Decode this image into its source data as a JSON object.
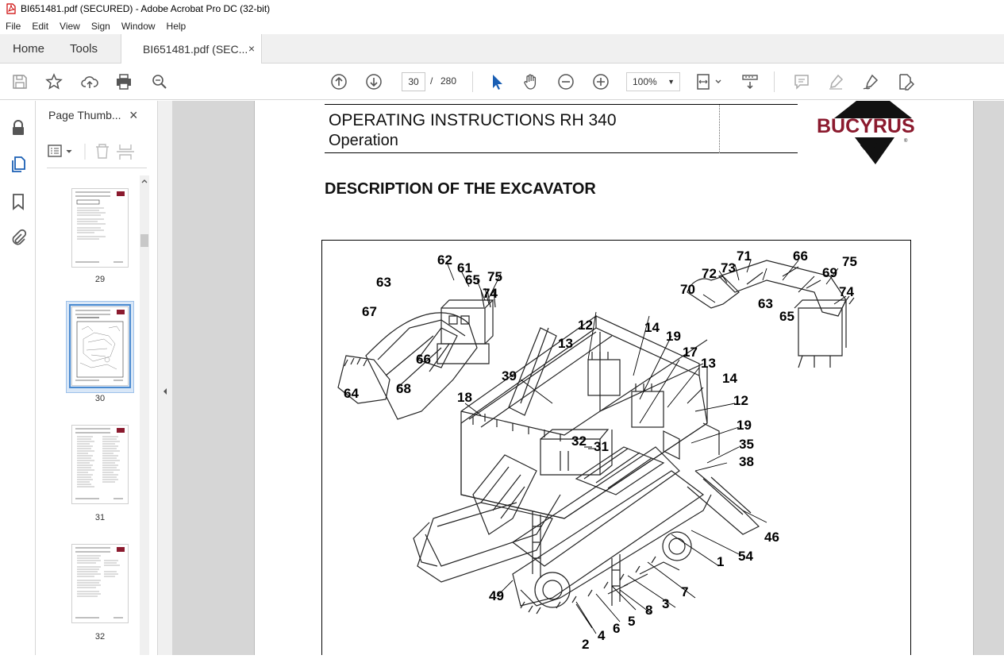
{
  "window": {
    "title": "BI651481.pdf (SECURED) - Adobe Acrobat Pro DC (32-bit)"
  },
  "menu": [
    "File",
    "Edit",
    "View",
    "Sign",
    "Window",
    "Help"
  ],
  "tabs": {
    "home": "Home",
    "tools": "Tools",
    "document": "BI651481.pdf (SEC...",
    "close": "×"
  },
  "toolbar": {
    "current_page": "30",
    "separator": "/",
    "total_pages": "280",
    "zoom": "100%"
  },
  "thumbnails_panel": {
    "title": "Page Thumb...",
    "close": "×",
    "pages": [
      {
        "number": "29"
      },
      {
        "number": "30",
        "selected": true
      },
      {
        "number": "31"
      },
      {
        "number": "32"
      }
    ]
  },
  "document": {
    "header_line1": "OPERATING INSTRUCTIONS RH 340",
    "header_line2": "Operation",
    "section_title": "DESCRIPTION OF THE EXCAVATOR",
    "logo_text": "BUCYRUS",
    "brand_color": "#8b1a2e",
    "callouts": [
      "62",
      "61",
      "63",
      "65",
      "75",
      "74",
      "67",
      "66",
      "64",
      "68",
      "71",
      "66",
      "72",
      "73",
      "75",
      "70",
      "69",
      "74",
      "63",
      "65",
      "12",
      "14",
      "19",
      "13",
      "17",
      "13",
      "39",
      "14",
      "18",
      "12",
      "19",
      "32",
      "31",
      "35",
      "38",
      "46",
      "1",
      "54",
      "7",
      "49",
      "3",
      "8",
      "5",
      "6",
      "4",
      "2"
    ]
  }
}
